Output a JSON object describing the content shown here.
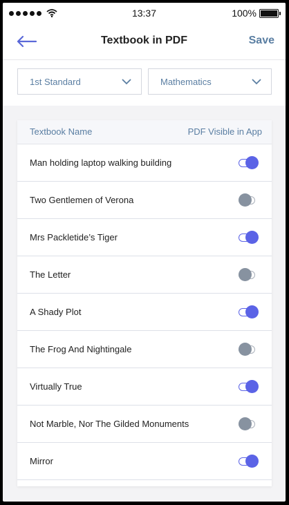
{
  "status": {
    "time": "13:37",
    "battery": "100%"
  },
  "nav": {
    "title": "Textbook in PDF",
    "save_label": "Save"
  },
  "filters": {
    "standard": "1st Standard",
    "subject": "Mathematics"
  },
  "table": {
    "col_name": "Textbook Name",
    "col_pdf": "PDF Visible in App",
    "rows": [
      {
        "name": "Man holding laptop walking building",
        "visible": true
      },
      {
        "name": "Two Gentlemen of Verona",
        "visible": false
      },
      {
        "name": "Mrs Packletide’s Tiger",
        "visible": true
      },
      {
        "name": "The Letter",
        "visible": false
      },
      {
        "name": "A Shady Plot",
        "visible": true
      },
      {
        "name": "The Frog And Nightingale",
        "visible": false
      },
      {
        "name": "Virtually True",
        "visible": true
      },
      {
        "name": "Not Marble, Nor The Gilded Monuments",
        "visible": false
      },
      {
        "name": "Mirror",
        "visible": true
      }
    ]
  },
  "colors": {
    "accent": "#5b63e6",
    "link": "#5a7ea2",
    "toggle_off": "#8792a0"
  }
}
